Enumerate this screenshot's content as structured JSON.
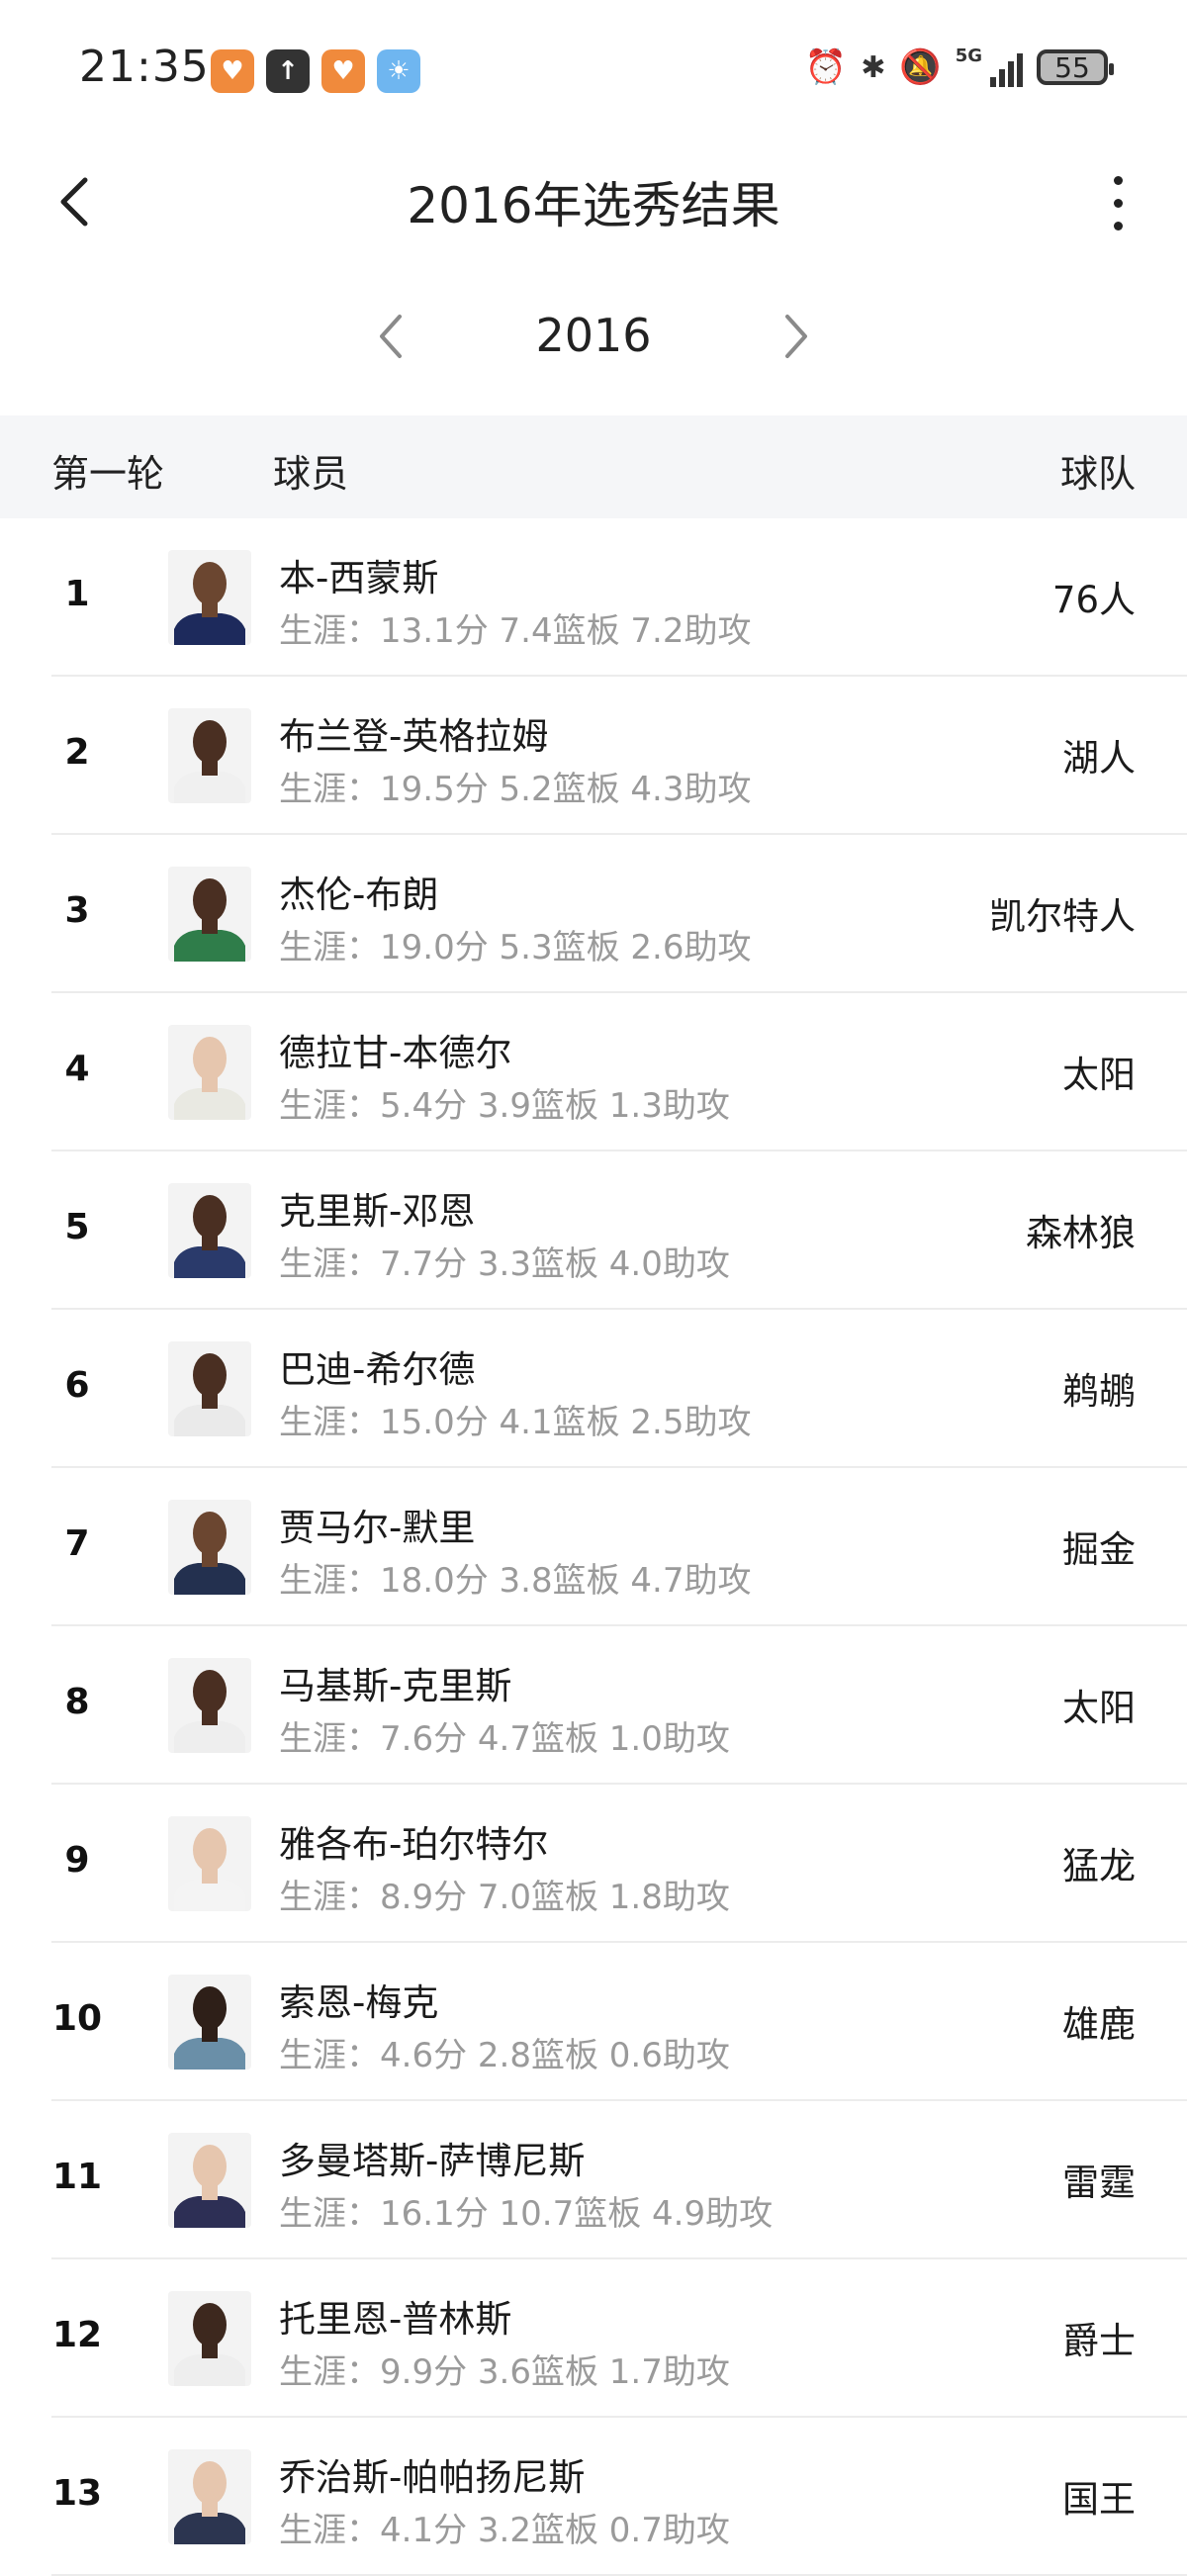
{
  "status_bar": {
    "time": "21:35",
    "network": "5G",
    "battery": "55",
    "icons": [
      "alarm-icon",
      "bluetooth-icon",
      "mute-icon",
      "signal-icon"
    ]
  },
  "nav": {
    "title": "2016年选秀结果"
  },
  "year_selector": {
    "year": "2016"
  },
  "table": {
    "headers": {
      "round": "第一轮",
      "player": "球员",
      "team": "球队"
    },
    "rows": [
      {
        "rank": "1",
        "name": "本-西蒙斯",
        "stats": "生涯：13.1分 7.4篮板 7.2助攻",
        "team": "76人",
        "jersey": "#1d2a5c",
        "skin": "#6b4630"
      },
      {
        "rank": "2",
        "name": "布兰登-英格拉姆",
        "stats": "生涯：19.5分 5.2篮板 4.3助攻",
        "team": "湖人",
        "jersey": "#f0f0f0",
        "skin": "#4a2f22"
      },
      {
        "rank": "3",
        "name": "杰伦-布朗",
        "stats": "生涯：19.0分 5.3篮板 2.6助攻",
        "team": "凯尔特人",
        "jersey": "#2f7d4a",
        "skin": "#4a2f22"
      },
      {
        "rank": "4",
        "name": "德拉甘-本德尔",
        "stats": "生涯：5.4分 3.9篮板 1.3助攻",
        "team": "太阳",
        "jersey": "#e9e9e2",
        "skin": "#e6c6ae"
      },
      {
        "rank": "5",
        "name": "克里斯-邓恩",
        "stats": "生涯：7.7分 3.3篮板 4.0助攻",
        "team": "森林狼",
        "jersey": "#2a3a6b",
        "skin": "#4a2f22"
      },
      {
        "rank": "6",
        "name": "巴迪-希尔德",
        "stats": "生涯：15.0分 4.1篮板 2.5助攻",
        "team": "鹈鹕",
        "jersey": "#eaeaea",
        "skin": "#4a2f22"
      },
      {
        "rank": "7",
        "name": "贾马尔-默里",
        "stats": "生涯：18.0分 3.8篮板 4.7助攻",
        "team": "掘金",
        "jersey": "#23304f",
        "skin": "#6b4630"
      },
      {
        "rank": "8",
        "name": "马基斯-克里斯",
        "stats": "生涯：7.6分 4.7篮板 1.0助攻",
        "team": "太阳",
        "jersey": "#eeeeee",
        "skin": "#4a2f22"
      },
      {
        "rank": "9",
        "name": "雅各布-珀尔特尔",
        "stats": "生涯：8.9分 7.0篮板 1.8助攻",
        "team": "猛龙",
        "jersey": "#f4f4f4",
        "skin": "#e6c6ae"
      },
      {
        "rank": "10",
        "name": "索恩-梅克",
        "stats": "生涯：4.6分 2.8篮板 0.6助攻",
        "team": "雄鹿",
        "jersey": "#6a8fa8",
        "skin": "#2e1f18"
      },
      {
        "rank": "11",
        "name": "多曼塔斯-萨博尼斯",
        "stats": "生涯：16.1分 10.7篮板 4.9助攻",
        "team": "雷霆",
        "jersey": "#2d2f55",
        "skin": "#e6c6ae"
      },
      {
        "rank": "12",
        "name": "托里恩-普林斯",
        "stats": "生涯：9.9分 3.6篮板 1.7助攻",
        "team": "爵士",
        "jersey": "#eeeeee",
        "skin": "#3d281e"
      },
      {
        "rank": "13",
        "name": "乔治斯-帕帕扬尼斯",
        "stats": "生涯：4.1分 3.2篮板 0.7助攻",
        "team": "国王",
        "jersey": "#2c3550",
        "skin": "#e6c6ae"
      }
    ]
  }
}
